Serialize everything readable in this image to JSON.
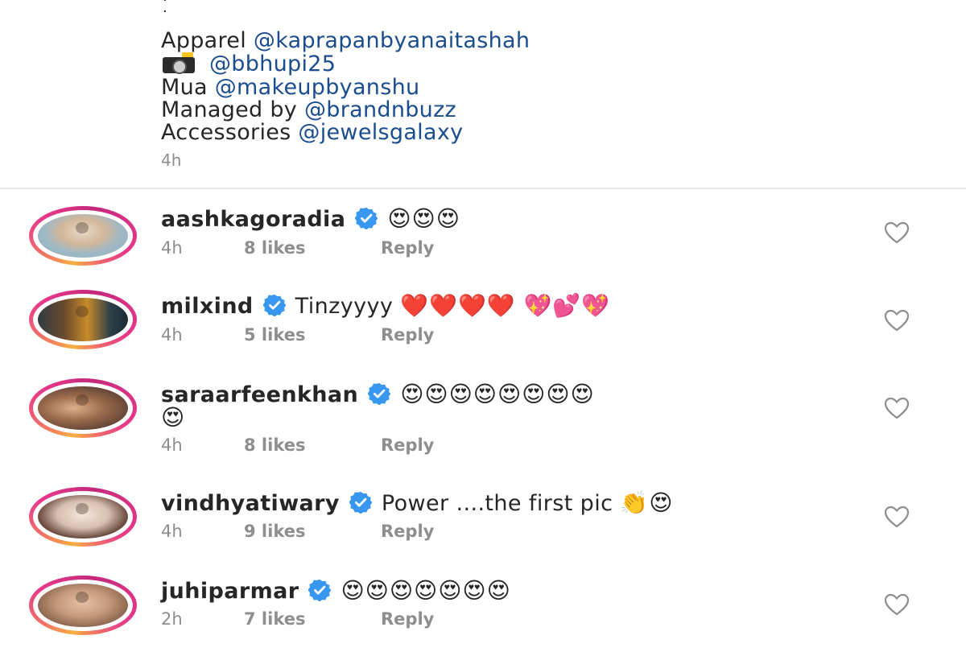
{
  "caption": {
    "lines": [
      {
        "prefix": "Apparel ",
        "mention": "@kaprapanbyanaitashah"
      },
      {
        "prefix": "",
        "mention": "@bbhupi25",
        "icon": "camera-flash-icon"
      },
      {
        "prefix": "Mua ",
        "mention": "@makeupbyanshu"
      },
      {
        "prefix": "Managed by ",
        "mention": "@brandnbuzz"
      },
      {
        "prefix": "Accessories ",
        "mention": "@jewelsgalaxy"
      }
    ],
    "time": "4h"
  },
  "comments": [
    {
      "username": "aashkagoradia",
      "text": "",
      "emojis": "😍😍😍",
      "time": "4h",
      "likes": "8 likes",
      "reply": "Reply"
    },
    {
      "username": "milxind",
      "text": "Tinzyyyy ",
      "emojis": "❤️❤️❤️❤️ 💖💕💖",
      "time": "4h",
      "likes": "5 likes",
      "reply": "Reply"
    },
    {
      "username": "saraarfeenkhan",
      "text": "",
      "emojis": "😍😍😍😍😍😍😍😍",
      "emojis2": "😍",
      "time": "4h",
      "likes": "8 likes",
      "reply": "Reply"
    },
    {
      "username": "vindhyatiwary",
      "text": "Power ....the first pic ",
      "emojis": "👏😍",
      "time": "4h",
      "likes": "9 likes",
      "reply": "Reply"
    },
    {
      "username": "juhiparmar",
      "text": "",
      "emojis": "😍😍😍😍😍😍😍",
      "time": "2h",
      "likes": "7 likes",
      "reply": "Reply"
    }
  ],
  "colors": {
    "mention": "#1a4d8f",
    "verified": "#3897f0",
    "muted": "#8e8e8e"
  }
}
